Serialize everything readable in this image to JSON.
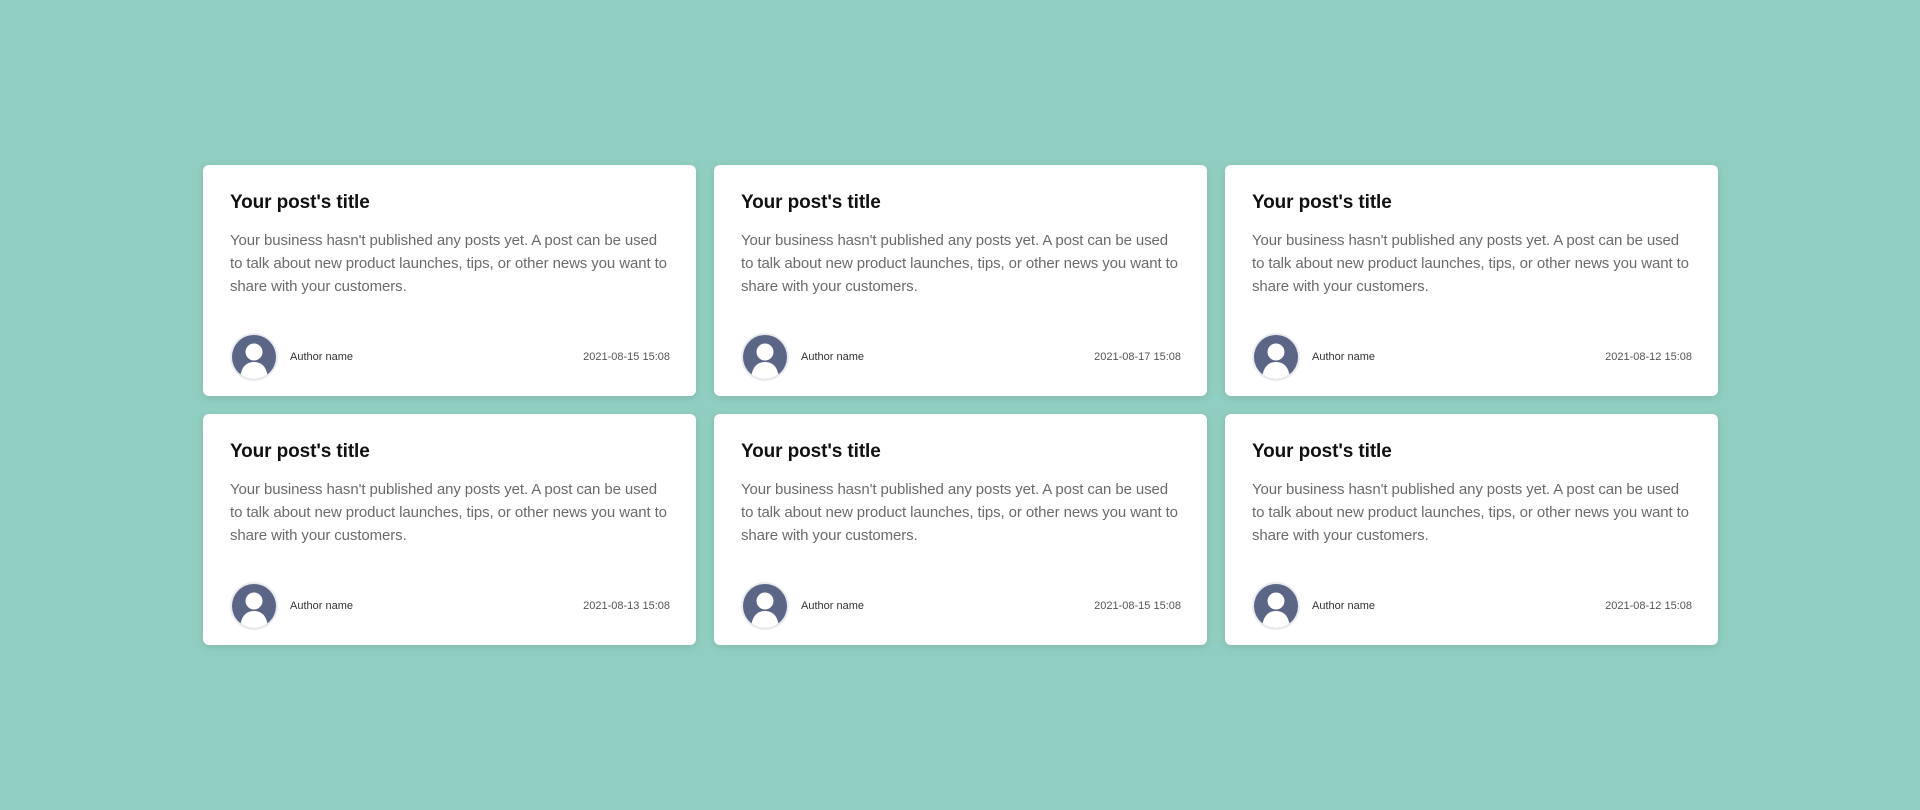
{
  "posts": [
    {
      "title": "Your post's title",
      "excerpt": "Your business hasn't published any posts yet. A post can be used to talk about new product launches, tips, or other news you want to share with your customers.",
      "author": "Author name",
      "date": "2021-08-15 15:08"
    },
    {
      "title": "Your post's title",
      "excerpt": "Your business hasn't published any posts yet. A post can be used to talk about new product launches, tips, or other news you want to share with your customers.",
      "author": "Author name",
      "date": "2021-08-17 15:08"
    },
    {
      "title": "Your post's title",
      "excerpt": "Your business hasn't published any posts yet. A post can be used to talk about new product launches, tips, or other news you want to share with your customers.",
      "author": "Author name",
      "date": "2021-08-12 15:08"
    },
    {
      "title": "Your post's title",
      "excerpt": "Your business hasn't published any posts yet. A post can be used to talk about new product launches, tips, or other news you want to share with your customers.",
      "author": "Author name",
      "date": "2021-08-13 15:08"
    },
    {
      "title": "Your post's title",
      "excerpt": "Your business hasn't published any posts yet. A post can be used to talk about new product launches, tips, or other news you want to share with your customers.",
      "author": "Author name",
      "date": "2021-08-15 15:08"
    },
    {
      "title": "Your post's title",
      "excerpt": "Your business hasn't published any posts yet. A post can be used to talk about new product launches, tips, or other news you want to share with your customers.",
      "author": "Author name",
      "date": "2021-08-12 15:08"
    }
  ],
  "avatar_icon": "user-silhouette-icon",
  "colors": {
    "background": "#91cec2",
    "card": "#ffffff",
    "avatar": "#5b6585"
  }
}
